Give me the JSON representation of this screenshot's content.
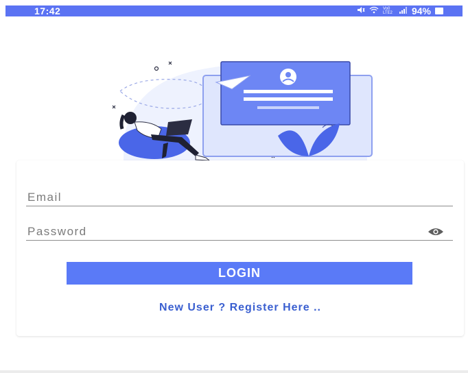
{
  "status_bar": {
    "time": "17:42",
    "network_label": "Vo0 LTE2",
    "battery_percent": "94%",
    "icons": [
      "mute-icon",
      "wifi-icon",
      "signal-icon",
      "battery-icon"
    ]
  },
  "illustration": {
    "icon": "person-with-laptop-login-illustration"
  },
  "form": {
    "email": {
      "placeholder": "Email",
      "value": ""
    },
    "password": {
      "placeholder": "Password",
      "value": "",
      "toggle_icon": "eye-icon"
    },
    "login_label": "LOGIN",
    "register_link": "New User ? Register Here .."
  },
  "colors": {
    "accent": "#5a7af7",
    "status_bar": "#5b73f3",
    "link": "#3a5fd0",
    "underline": "#8c8c8c"
  }
}
